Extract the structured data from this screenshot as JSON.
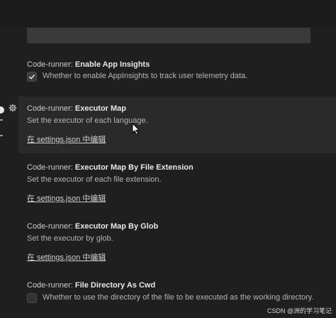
{
  "settings": [
    {
      "category": "Code-runner: ",
      "name": "Enable App Insights",
      "checkbox_label": "Whether to enable AppInsights to track user telemetry data.",
      "checked": true
    },
    {
      "category": "Code-runner: ",
      "name": "Executor Map",
      "description": "Set the executor of each language.",
      "link": "在 settings.json 中编辑"
    },
    {
      "category": "Code-runner: ",
      "name": "Executor Map By File Extension",
      "description": "Set the executor of each file extension.",
      "link": "在 settings.json 中编辑"
    },
    {
      "category": "Code-runner: ",
      "name": "Executor Map By Glob",
      "description": "Set the executor by glob.",
      "link": "在 settings.json 中编辑"
    },
    {
      "category": "Code-runner: ",
      "name": "File Directory As Cwd",
      "checkbox_label": "Whether to use the directory of the file to be executed as the working directory.",
      "checked": false
    }
  ],
  "watermark": "CSDN @洲的学习笔记",
  "icons": {
    "gear": "gear-icon",
    "check": "check-icon",
    "cursor": "mouse-cursor-icon"
  }
}
